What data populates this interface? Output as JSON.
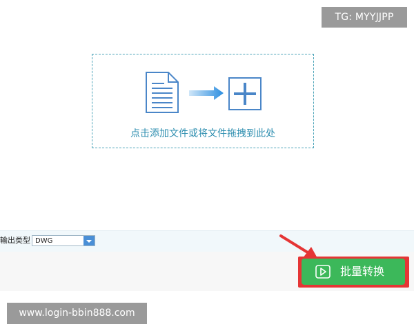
{
  "watermarks": {
    "top_right": "TG: MYYJJPP",
    "bottom_left": "www.login-bbin888.com"
  },
  "drop_zone": {
    "text": "点击添加文件或将文件拖拽到此处",
    "icons": [
      "document-icon",
      "arrow-right-icon",
      "plus-icon"
    ]
  },
  "output": {
    "label": "输出类型",
    "selected": "DWG"
  },
  "actions": {
    "convert_label": "批量转换",
    "convert_icon": "play-icon"
  },
  "colors": {
    "accent_blue": "#2f8fb0",
    "button_green": "#3cb85a",
    "highlight_red": "#e53535"
  }
}
